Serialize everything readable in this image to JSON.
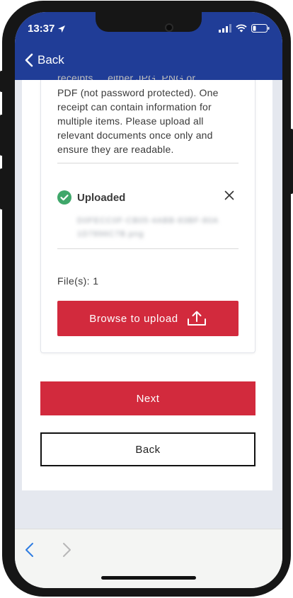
{
  "status_bar": {
    "time": "13:37"
  },
  "header": {
    "back_label": "Back",
    "background_color": "#203d97"
  },
  "upload_card": {
    "instructions_partial_top": "receipts ... either JPG, PNG or",
    "instructions": "PDF (not password protected). One receipt can contain information for multiple items. Please upload all relevant documents once only and ensure they are readable.",
    "uploaded_label": "Uploaded",
    "uploaded_icon": "check-circle-icon",
    "filename_line_1": "D0FECC0F-CB05-4ABB-83BF-80A",
    "filename_line_2": "1D7896C7B.png",
    "file_count": "File(s): 1",
    "browse_label": "Browse to upload",
    "browse_icon": "upload-icon",
    "accent_color": "#d22a3d",
    "success_color": "#3fa76a"
  },
  "actions": {
    "next_label": "Next",
    "back_label": "Back"
  },
  "browser_toolbar": {
    "back_icon": "chevron-left-icon",
    "forward_icon": "chevron-right-icon",
    "back_color": "#2f7de1",
    "forward_color": "#b7b7b7"
  }
}
